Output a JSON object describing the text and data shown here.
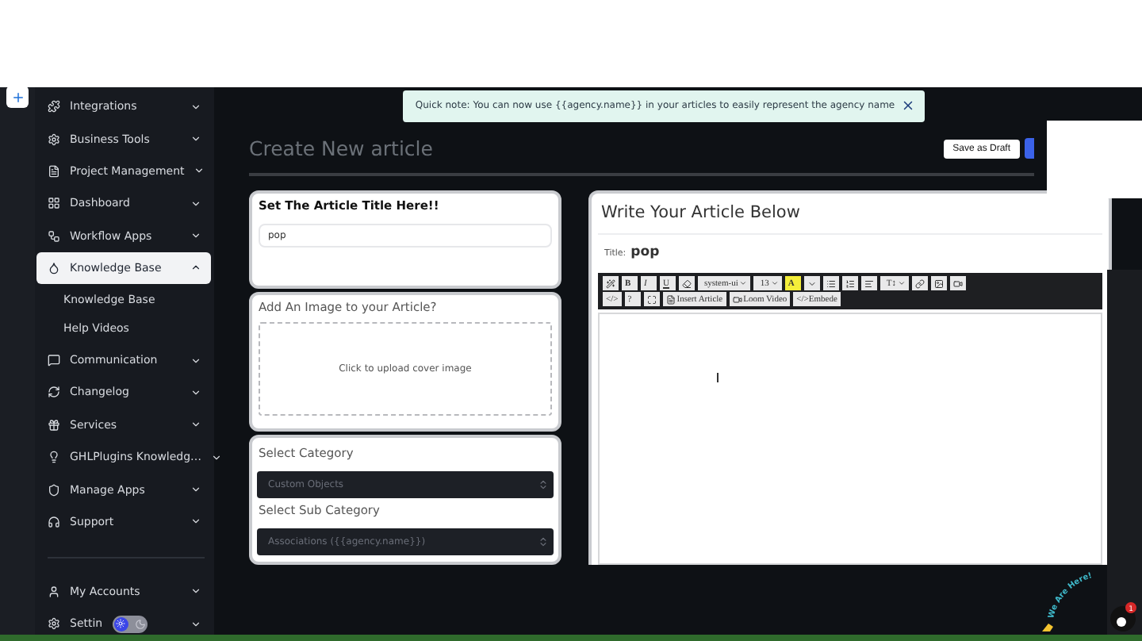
{
  "sidebar": {
    "items": [
      {
        "label": "Integrations",
        "selected": false,
        "expanded": false
      },
      {
        "label": "Business Tools",
        "selected": false,
        "expanded": false
      },
      {
        "label": "Project Management",
        "selected": false,
        "expanded": false
      },
      {
        "label": "Dashboard",
        "selected": false,
        "expanded": false
      },
      {
        "label": "Workflow Apps",
        "selected": false,
        "expanded": false
      },
      {
        "label": "Knowledge Base",
        "selected": true,
        "expanded": true,
        "children": [
          {
            "label": "Knowledge Base"
          },
          {
            "label": "Help Videos"
          }
        ]
      },
      {
        "label": "Communication",
        "selected": false,
        "expanded": false
      },
      {
        "label": "Changelog",
        "selected": false,
        "expanded": false
      },
      {
        "label": "Services",
        "selected": false,
        "expanded": false
      },
      {
        "label": "GHLPlugins Knowledg…",
        "selected": false,
        "expanded": false
      },
      {
        "label": "Manage Apps",
        "selected": false,
        "expanded": false
      },
      {
        "label": "Support",
        "selected": false,
        "expanded": false
      }
    ],
    "footer_items": [
      {
        "label": "My Accounts"
      },
      {
        "label": "Settin"
      }
    ],
    "theme_toggle": {
      "on": false
    }
  },
  "toast": {
    "text": "Quick note: You can now use {{agency.name}} in your articles to easily represent the agency name"
  },
  "page": {
    "title": "Create New article",
    "buttons": [
      "Save as Draft"
    ]
  },
  "title_card": {
    "heading": "Set The Article Title Here!!",
    "value": "pop"
  },
  "image_card": {
    "heading": "Add An Image to your Article?",
    "dropzone": "Click to upload cover image"
  },
  "category_card": {
    "fields": [
      {
        "label": "Select Category",
        "placeholder": "Custom Objects"
      },
      {
        "label": "Select Sub Category",
        "placeholder": "Associations ({{agency.name}})"
      }
    ]
  },
  "editor": {
    "heading": "Write Your Article Below",
    "title_label": "Title:",
    "title_value": "pop",
    "toolbar_rows": [
      [
        {
          "kind": "icon"
        },
        {
          "kind": "bold",
          "label": "B"
        },
        {
          "kind": "italic",
          "label": "I"
        },
        {
          "kind": "underline",
          "label": "U"
        },
        {
          "kind": "icon"
        },
        {
          "kind": "dropdown",
          "label": "system-ui"
        },
        {
          "kind": "dropdown",
          "label": "13"
        },
        {
          "kind": "highlight",
          "label": "A"
        },
        {
          "kind": "icon"
        },
        {
          "kind": "icon"
        },
        {
          "kind": "icon"
        },
        {
          "kind": "icon"
        },
        {
          "kind": "dropdown",
          "label": "T↕"
        },
        {
          "kind": "icon"
        },
        {
          "kind": "icon"
        },
        {
          "kind": "icon"
        }
      ],
      [
        {
          "kind": "text",
          "label": "</>"
        },
        {
          "kind": "text",
          "label": "?"
        },
        {
          "kind": "icon"
        },
        {
          "kind": "labeled",
          "label": "Insert Article"
        },
        {
          "kind": "labeled",
          "label": "Loom Video"
        },
        {
          "kind": "text",
          "label": "</>Embede"
        }
      ]
    ]
  },
  "chat_widget": {
    "text": "We Are Here!",
    "badge": "1"
  }
}
